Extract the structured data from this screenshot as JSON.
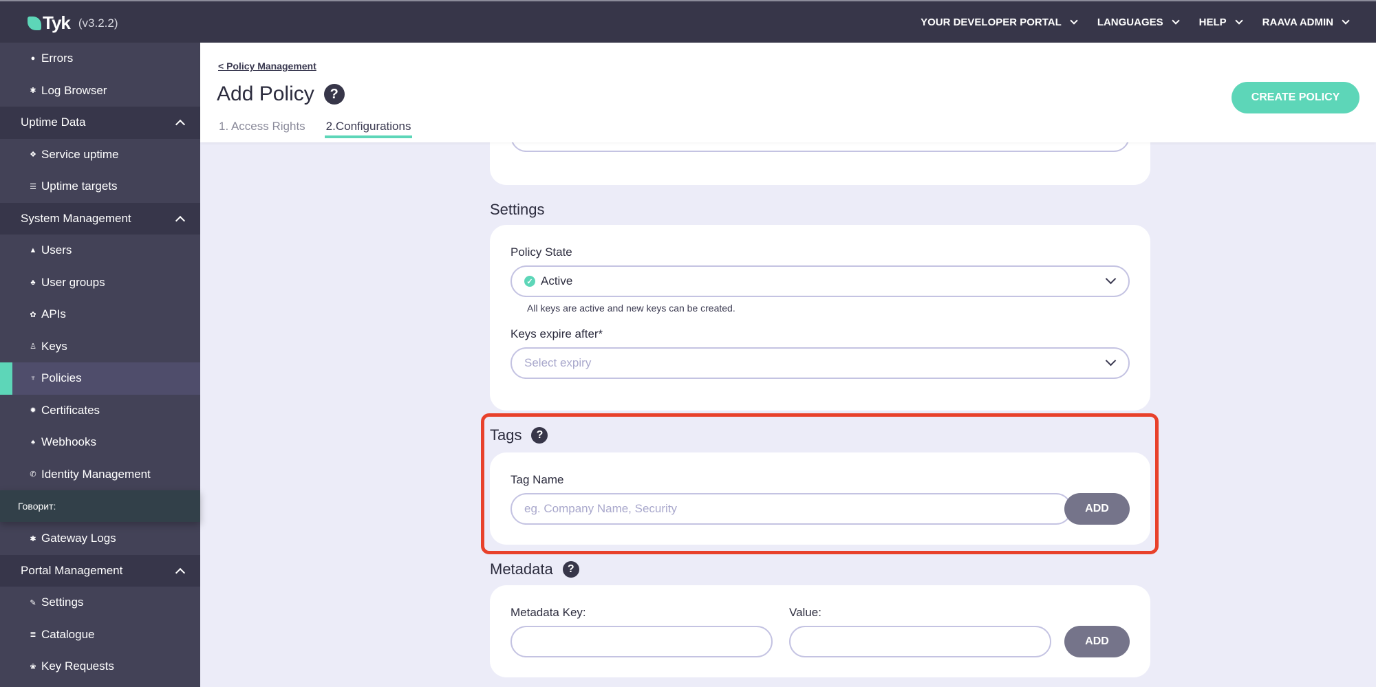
{
  "app": {
    "logo_text": "Tyk",
    "version": "(v3.2.2)"
  },
  "topnav": [
    {
      "label": "YOUR DEVELOPER PORTAL",
      "icon": "chevron-down-icon"
    },
    {
      "label": "LANGUAGES",
      "icon": "chevron-down-icon"
    },
    {
      "label": "HELP",
      "icon": "chevron-down-icon"
    },
    {
      "label": "RAAVA ADMIN",
      "icon": "chevron-down-icon"
    }
  ],
  "sidebar": {
    "items": [
      {
        "label": "Errors",
        "icon": "bomb-icon",
        "glyph": "●"
      },
      {
        "label": "Log Browser",
        "icon": "bug-icon",
        "glyph": "✱"
      }
    ],
    "uptime_group": "Uptime Data",
    "uptime_items": [
      {
        "label": "Service uptime",
        "icon": "cubes-icon",
        "glyph": "❖"
      },
      {
        "label": "Uptime targets",
        "icon": "list-icon",
        "glyph": "☰"
      }
    ],
    "system_group": "System Management",
    "system_items": [
      {
        "label": "Users",
        "icon": "user-icon",
        "glyph": "▲"
      },
      {
        "label": "User groups",
        "icon": "users-icon",
        "glyph": "♣"
      },
      {
        "label": "APIs",
        "icon": "cogs-icon",
        "glyph": "✿"
      },
      {
        "label": "Keys",
        "icon": "sitemap-icon",
        "glyph": "♙"
      },
      {
        "label": "Policies",
        "icon": "plug-icon",
        "glyph": "♆",
        "active": true
      },
      {
        "label": "Certificates",
        "icon": "certificate-icon",
        "glyph": "✹"
      },
      {
        "label": "Webhooks",
        "icon": "bell-icon",
        "glyph": "♠"
      },
      {
        "label": "Identity Management",
        "icon": "phone-icon",
        "glyph": "✆"
      }
    ],
    "tooltip": "Говорит:",
    "after_tooltip": [
      {
        "label": "Gateway Logs",
        "icon": "bug-icon",
        "glyph": "✱"
      }
    ],
    "portal_group": "Portal Management",
    "portal_items": [
      {
        "label": "Settings",
        "icon": "wrench-icon",
        "glyph": "✎"
      },
      {
        "label": "Catalogue",
        "icon": "database-icon",
        "glyph": "≣"
      },
      {
        "label": "Key Requests",
        "icon": "paw-icon",
        "glyph": "❀"
      }
    ]
  },
  "header": {
    "breadcrumb": "< Policy Management",
    "title": "Add Policy",
    "tabs": [
      {
        "label": "1. Access Rights",
        "active": false
      },
      {
        "label": "2.Configurations",
        "active": true
      }
    ],
    "create_button": "CREATE POLICY"
  },
  "settings": {
    "title": "Settings",
    "policy_state_label": "Policy State",
    "policy_state_value": "Active",
    "policy_state_hint": "All keys are active and new keys can be created.",
    "expiry_label": "Keys expire after*",
    "expiry_placeholder": "Select expiry"
  },
  "tags": {
    "title": "Tags",
    "tag_name_label": "Tag Name",
    "tag_name_placeholder": "eg. Company Name, Security",
    "tag_name_value": "",
    "add_button": "ADD"
  },
  "metadata": {
    "title": "Metadata",
    "key_label": "Metadata Key:",
    "value_label": "Value:",
    "key_value": "",
    "value_value": "",
    "add_button": "ADD"
  },
  "colors": {
    "accent": "#5DD6B8",
    "topbar": "#373649",
    "sidebar": "#434257",
    "highlight": "#E8412B",
    "add_button": "#75748A"
  }
}
